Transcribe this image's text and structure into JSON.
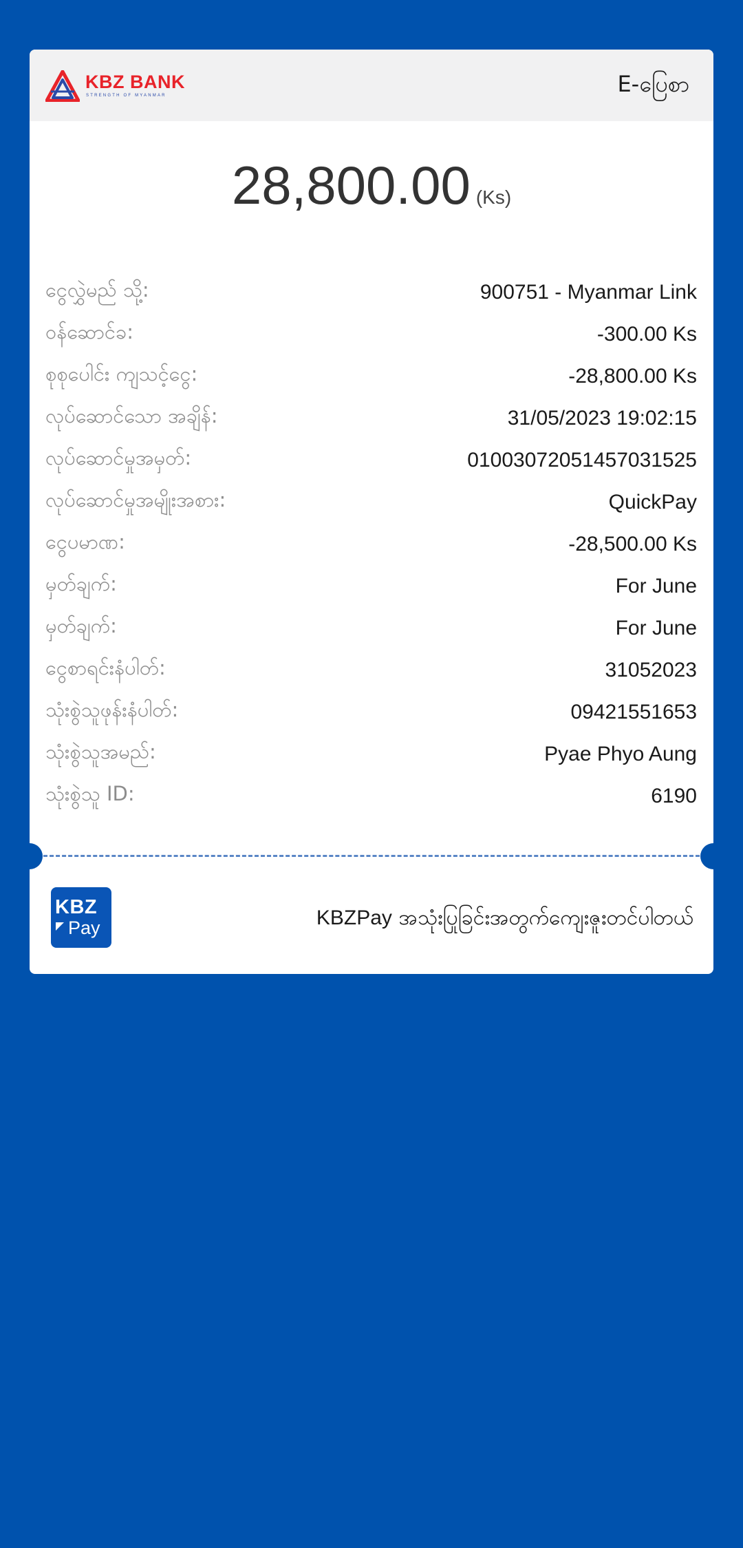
{
  "header": {
    "logo_text": "KBZ BANK",
    "logo_tagline": "STRENGTH OF MYANMAR",
    "title": "E-ပြေစာ"
  },
  "amount": {
    "value": "28,800.00",
    "unit": "(Ks)"
  },
  "details": [
    {
      "label": "ငွေလွှဲမည် သို့:",
      "value": "900751 - Myanmar Link"
    },
    {
      "label": "ဝန်ဆောင်ခ:",
      "value": "-300.00 Ks"
    },
    {
      "label": "စုစုပေါင်း ကျသင့်ငွေ:",
      "value": "-28,800.00 Ks"
    },
    {
      "label": "လုပ်ဆောင်သော အချိန်:",
      "value": "31/05/2023 19:02:15"
    },
    {
      "label": "လုပ်ဆောင်မှုအမှတ်:",
      "value": "01003072051457031525"
    },
    {
      "label": "လုပ်ဆောင်မှုအမျိုးအစား:",
      "value": "QuickPay"
    },
    {
      "label": "ငွေပမာဏ:",
      "value": "-28,500.00 Ks"
    },
    {
      "label": "မှတ်ချက်:",
      "value": "For June"
    },
    {
      "label": "မှတ်ချက်:",
      "value": "For June"
    },
    {
      "label": "ငွေစာရင်းနံပါတ်:",
      "value": "31052023"
    },
    {
      "label": "သုံးစွဲသူဖုန်းနံပါတ်:",
      "value": "09421551653"
    },
    {
      "label": "သုံးစွဲသူအမည်:",
      "value": "Pyae Phyo Aung"
    },
    {
      "label": "သုံးစွဲသူ ID:",
      "value": "6190"
    }
  ],
  "footer": {
    "logo_line1": "KBZ",
    "logo_line2": "Pay",
    "brand": "KBZPay",
    "message": " အသုံးပြုခြင်းအတွက်ကျေးဇူးတင်ပါတယ်"
  },
  "colors": {
    "background": "#0052ad",
    "card": "#ffffff",
    "header_bg": "#f1f1f2",
    "logo_red": "#e8232a",
    "logo_blue": "#2a4aa8",
    "divider": "#5a86c6",
    "label_gray": "#8d8d8d"
  },
  "icons": {
    "bank_logo": "kbz-triangle-logo",
    "pay_logo": "kbzpay-app-icon"
  }
}
